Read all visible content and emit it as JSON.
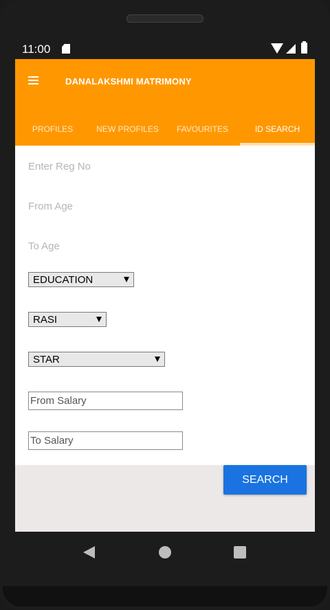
{
  "status_bar": {
    "time": "11:00"
  },
  "app_bar": {
    "title": "DANALAKSHMI MATRIMONY"
  },
  "tabs": [
    {
      "label": "PROFILES"
    },
    {
      "label": "NEW PROFILES"
    },
    {
      "label": "FAVOURITES"
    },
    {
      "label": "ID SEARCH",
      "active": true
    }
  ],
  "form": {
    "reg_no_placeholder": "Enter Reg No",
    "from_age_placeholder": "From Age",
    "to_age_placeholder": "To Age",
    "education_selected": "EDUCATION",
    "rasi_selected": "RASI",
    "star_selected": "STAR",
    "from_salary_placeholder": "From Salary",
    "to_salary_placeholder": "To Salary",
    "search_label": "SEARCH"
  },
  "colors": {
    "app_bar": "#ff9800",
    "search_button": "#1a73e0",
    "bottom_area": "#ece8e7"
  }
}
